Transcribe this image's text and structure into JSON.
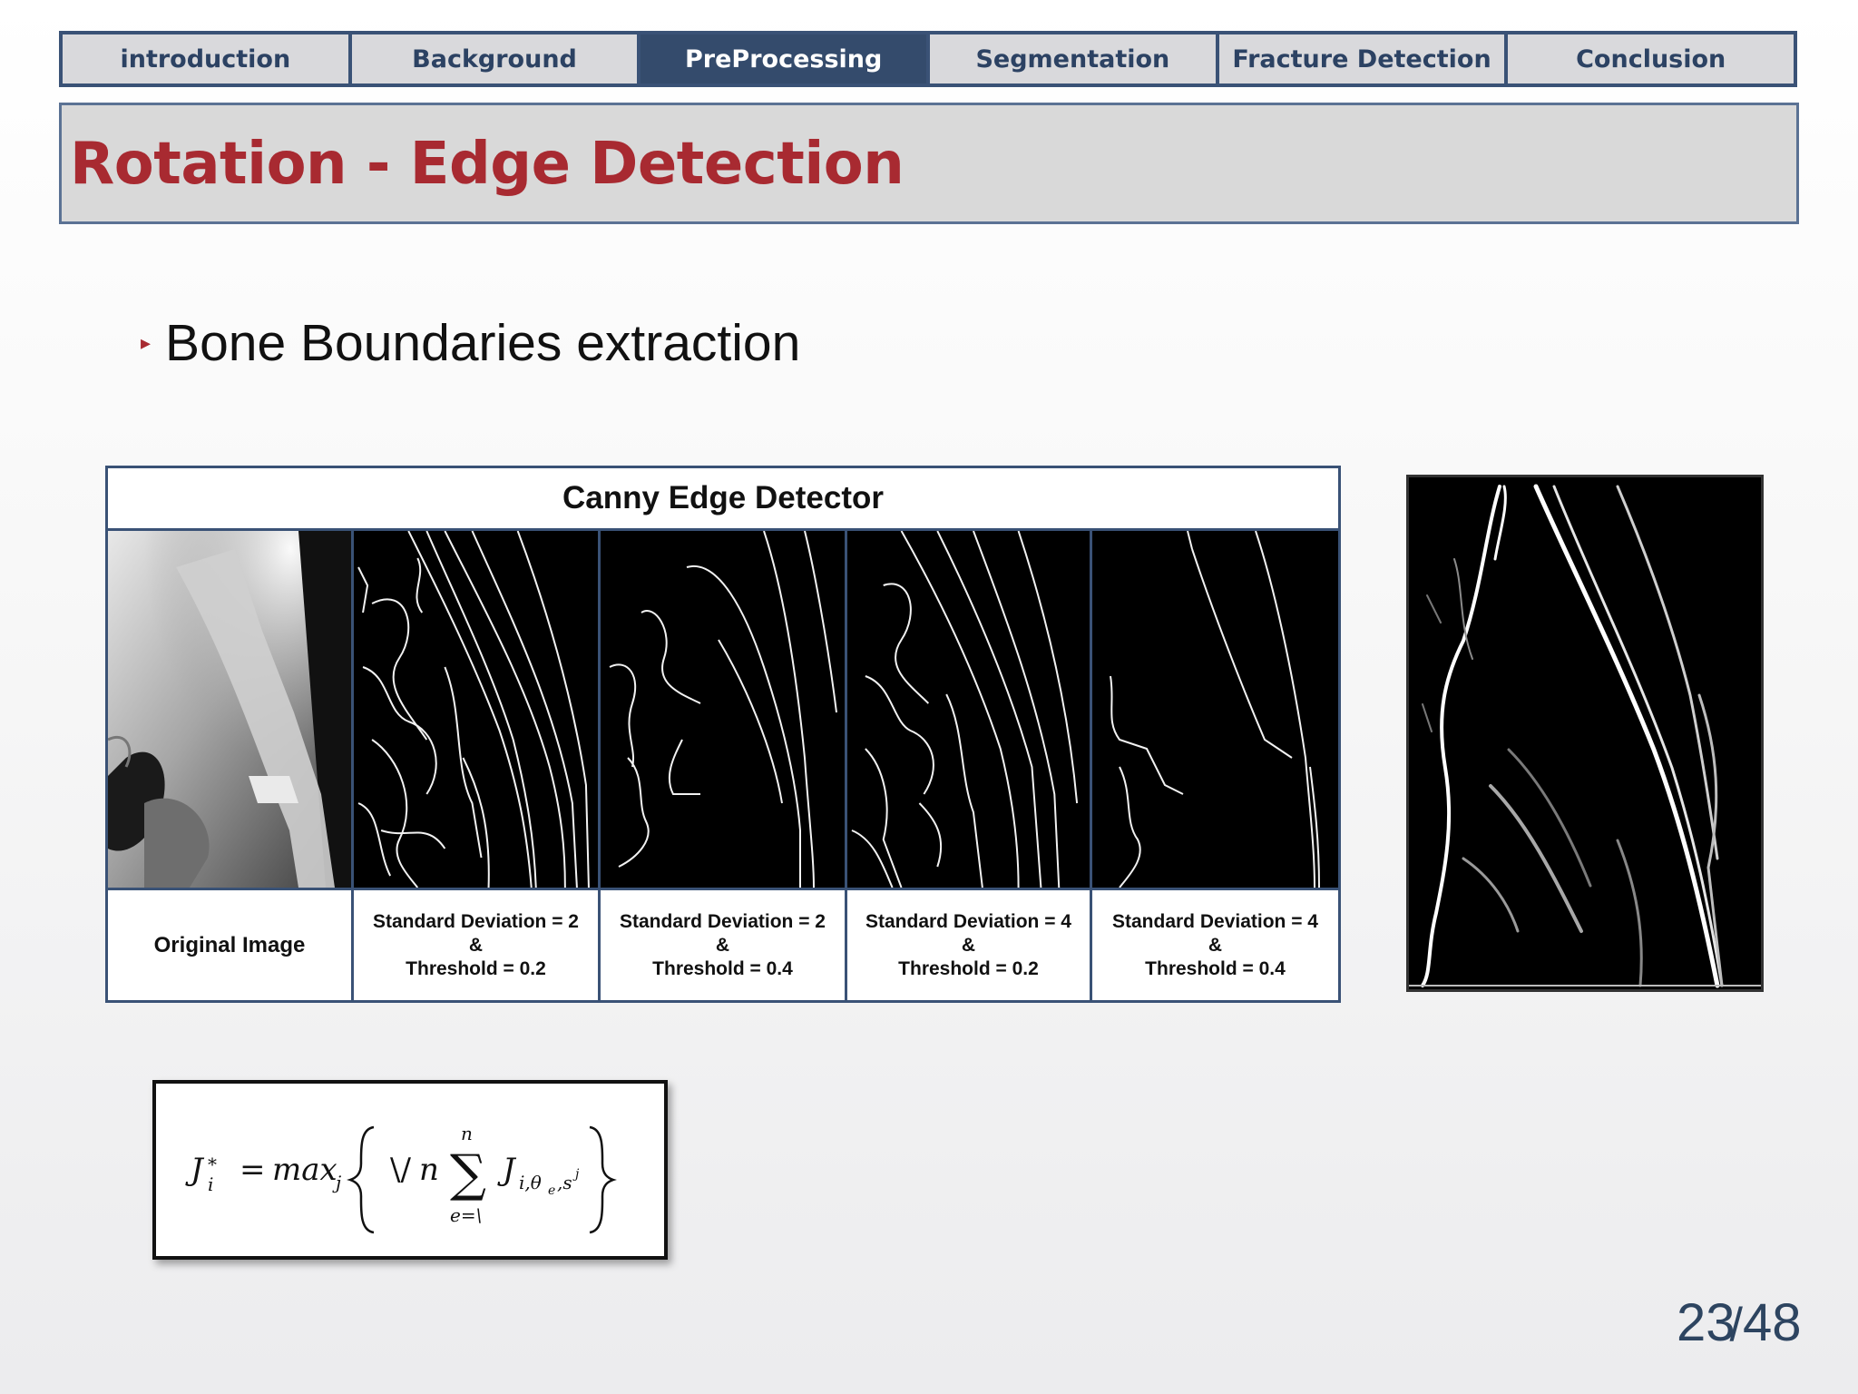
{
  "nav": {
    "tabs": [
      {
        "label": "introduction"
      },
      {
        "label": "Background"
      },
      {
        "label": "PreProcessing"
      },
      {
        "label": "Segmentation"
      },
      {
        "label": "Fracture Detection"
      },
      {
        "label": "Conclusion"
      }
    ],
    "active_tab": "PreProcessing"
  },
  "slide": {
    "title": "Rotation - Edge Detection",
    "bullet_marker": "▸",
    "bullet": "Bone Boundaries extraction"
  },
  "canny_table": {
    "header": "Canny Edge Detector",
    "columns": [
      {
        "label": "Original Image"
      },
      {
        "line1": "Standard Deviation = 2",
        "line2": "&",
        "line3": "Threshold = 0.2"
      },
      {
        "line1": "Standard Deviation = 2",
        "line2": "&",
        "line3": "Threshold = 0.4"
      },
      {
        "line1": "Standard Deviation = 4",
        "line2": "&",
        "line3": "Threshold = 0.2"
      },
      {
        "line1": "Standard Deviation = 4",
        "line2": "&",
        "line3": "Threshold = 0.4"
      }
    ]
  },
  "page": {
    "current": "23",
    "separator": "/",
    "total": "48"
  },
  "colors": {
    "accent": "#a82a31",
    "nav_border": "#3a5276",
    "nav_active_bg": "#344b6c",
    "nav_bg": "#d9d9dc"
  }
}
